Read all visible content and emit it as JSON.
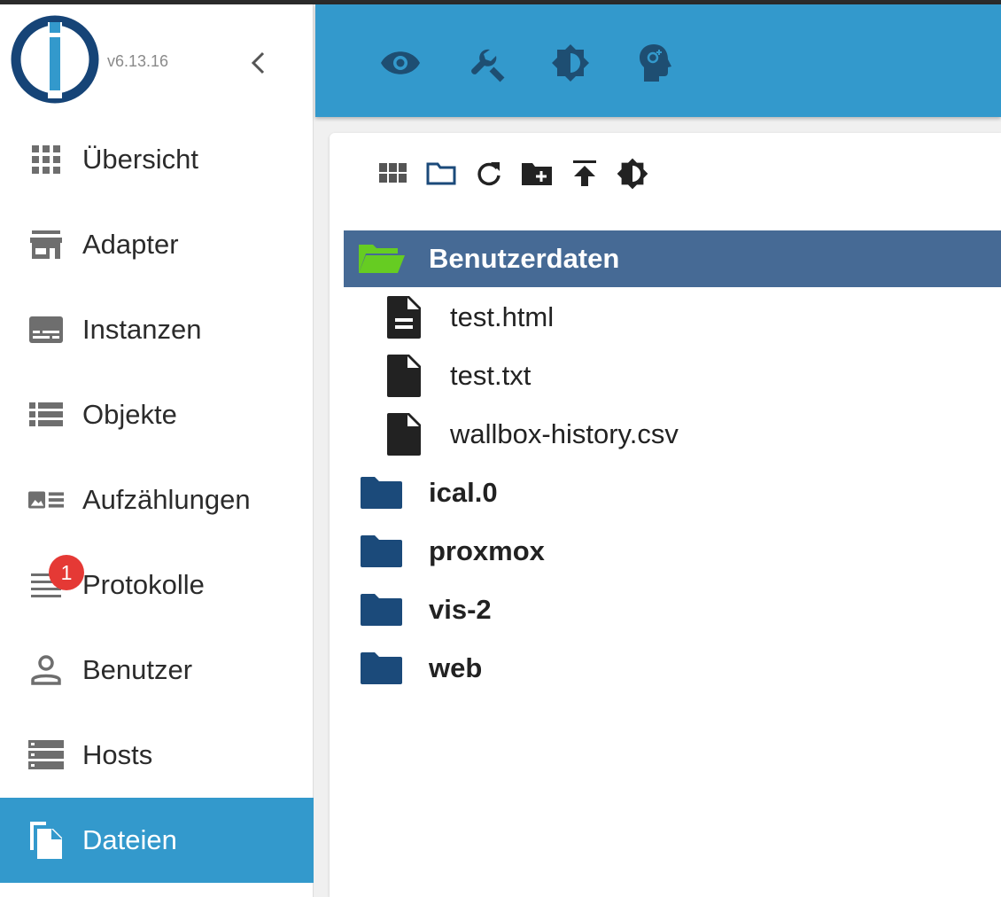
{
  "app": {
    "version": "v6.13.16"
  },
  "colors": {
    "accent": "#3399cc",
    "selected_row": "#466a95",
    "folder_open": "#66cc22",
    "folder": "#1b4a7a",
    "badge": "#e53935"
  },
  "sidebar": {
    "collapse_icon": "chevron-left-icon",
    "items": [
      {
        "label": "Übersicht",
        "icon": "apps-grid-icon"
      },
      {
        "label": "Adapter",
        "icon": "store-icon"
      },
      {
        "label": "Instanzen",
        "icon": "subtitles-icon"
      },
      {
        "label": "Objekte",
        "icon": "list-icon"
      },
      {
        "label": "Aufzählungen",
        "icon": "image-list-icon"
      },
      {
        "label": "Protokolle",
        "icon": "notes-icon",
        "badge": "1"
      },
      {
        "label": "Benutzer",
        "icon": "person-icon"
      },
      {
        "label": "Hosts",
        "icon": "storage-icon"
      },
      {
        "label": "Dateien",
        "icon": "files-icon",
        "active": true
      }
    ]
  },
  "header": {
    "buttons": [
      "eye-icon",
      "wrench-icon",
      "brightness-icon",
      "expert-mode-icon"
    ]
  },
  "toolbar": {
    "buttons": [
      "tile-view-icon",
      "folder-view-icon",
      "refresh-icon",
      "create-folder-icon",
      "upload-icon",
      "brightness-icon"
    ]
  },
  "files": [
    {
      "name": "Benutzerdaten",
      "type": "folder",
      "open": true,
      "selected": true
    },
    {
      "name": "test.html",
      "type": "file",
      "icon": "file-document-icon"
    },
    {
      "name": "test.txt",
      "type": "file",
      "icon": "file-icon"
    },
    {
      "name": "wallbox-history.csv",
      "type": "file",
      "icon": "file-icon"
    },
    {
      "name": "ical.0",
      "type": "folder"
    },
    {
      "name": "proxmox",
      "type": "folder"
    },
    {
      "name": "vis-2",
      "type": "folder"
    },
    {
      "name": "web",
      "type": "folder"
    }
  ]
}
